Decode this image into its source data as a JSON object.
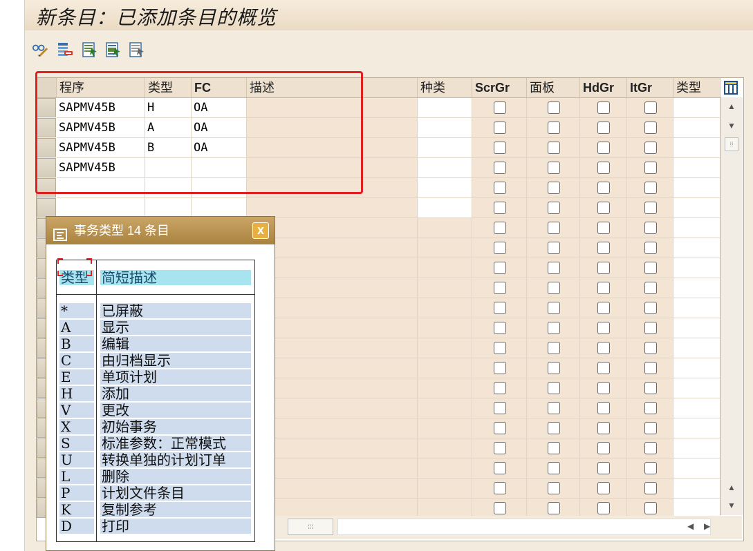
{
  "window": {
    "title": "新条目：已添加条目的概览"
  },
  "toolbar": {
    "icons": [
      "glasses-pencil-icon",
      "delete-row-icon",
      "select-all-icon",
      "select-block-icon",
      "deselect-all-icon"
    ]
  },
  "table": {
    "columns": [
      "程序",
      "类型",
      "FC",
      "描述",
      "种类",
      "ScrGr",
      "面板",
      "HdGr",
      "ItGr",
      "类型"
    ],
    "rows": [
      {
        "program": "SAPMV45B",
        "type": "H",
        "fc": "OA"
      },
      {
        "program": "SAPMV45B",
        "type": "A",
        "fc": "OA"
      },
      {
        "program": "SAPMV45B",
        "type": "B",
        "fc": "OA"
      },
      {
        "program": "SAPMV45B",
        "type": "",
        "fc": ""
      }
    ]
  },
  "popup": {
    "title": "事务类型 14 条目",
    "close_label": "x",
    "header_type": "类型",
    "header_desc": "简短描述",
    "items": [
      {
        "code": "*",
        "desc": "已屏蔽"
      },
      {
        "code": "A",
        "desc": "显示"
      },
      {
        "code": "B",
        "desc": "编辑"
      },
      {
        "code": "C",
        "desc": "由归档显示"
      },
      {
        "code": "E",
        "desc": "单项计划"
      },
      {
        "code": "H",
        "desc": "添加"
      },
      {
        "code": "V",
        "desc": "更改"
      },
      {
        "code": "X",
        "desc": "初始事务"
      },
      {
        "code": "S",
        "desc": "标准参数：正常模式"
      },
      {
        "code": "U",
        "desc": "转换单独的计划订单"
      },
      {
        "code": "L",
        "desc": "删除"
      },
      {
        "code": "P",
        "desc": "计划文件条目"
      },
      {
        "code": "K",
        "desc": "复制参考"
      },
      {
        "code": "D",
        "desc": "打印"
      }
    ]
  },
  "colors": {
    "highlight": "#e02020",
    "popup_title": "#b08a45",
    "selection_bg": "#cfdcee",
    "header_bg": "#a8e4f0"
  }
}
